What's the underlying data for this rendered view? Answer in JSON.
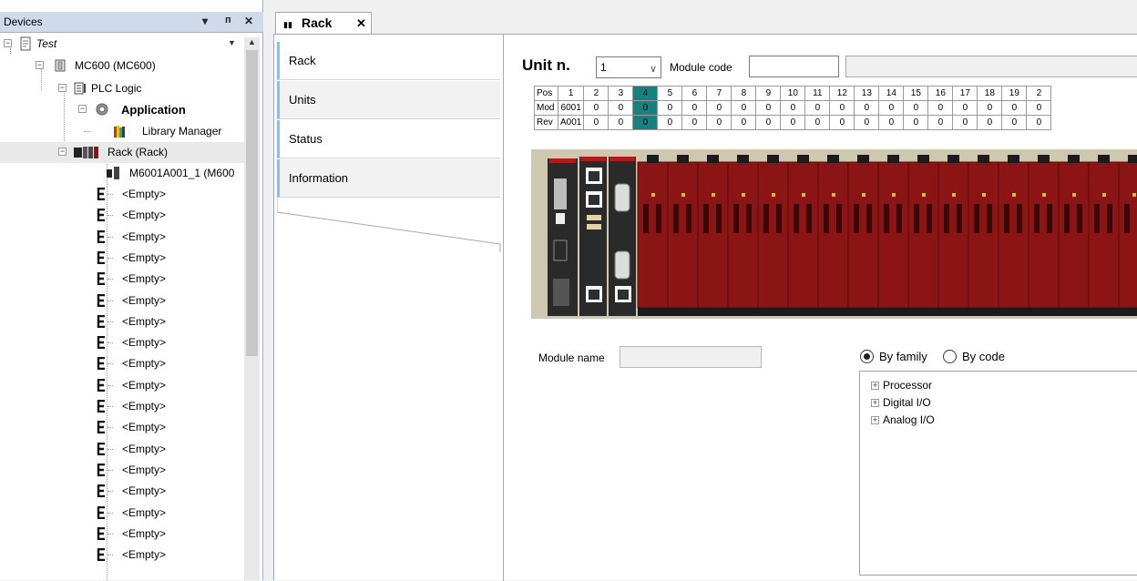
{
  "devices": {
    "title": "Devices",
    "pin_glyph": "▾",
    "pin2_glyph": "ᵖ",
    "close_glyph": "✕",
    "scroll_up_glyph": "▲",
    "root_dd_glyph": "▼",
    "tree": {
      "root": "Test",
      "device": "MC600 (MC600)",
      "plc_logic": "PLC Logic",
      "application": "Application",
      "library_manager": "Library Manager",
      "rack": "Rack (Rack)",
      "module": "M6001A001_1 (M600",
      "empty_slots": [
        "<Empty>",
        "<Empty>",
        "<Empty>",
        "<Empty>",
        "<Empty>",
        "<Empty>",
        "<Empty>",
        "<Empty>",
        "<Empty>",
        "<Empty>",
        "<Empty>",
        "<Empty>",
        "<Empty>",
        "<Empty>",
        "<Empty>",
        "<Empty>",
        "<Empty>",
        "<Empty>"
      ]
    }
  },
  "editor": {
    "tab_label": "Rack",
    "tab_close": "✕",
    "side_tabs": [
      "Rack",
      "Units",
      "Status",
      "Information"
    ],
    "unit_label": "Unit n.",
    "unit_value": "1",
    "unit_arrow": "∨",
    "module_code_label": "Module code",
    "module_code_value": "",
    "grid": {
      "row_headers": [
        "Pos",
        "Mod",
        "Rev"
      ],
      "positions": [
        "1",
        "2",
        "3",
        "4",
        "5",
        "6",
        "7",
        "8",
        "9",
        "10",
        "11",
        "12",
        "13",
        "14",
        "15",
        "16",
        "17",
        "18",
        "19",
        "2"
      ],
      "mod": [
        "6001",
        "0",
        "0",
        "0",
        "0",
        "0",
        "0",
        "0",
        "0",
        "0",
        "0",
        "0",
        "0",
        "0",
        "0",
        "0",
        "0",
        "0",
        "0",
        "0"
      ],
      "rev": [
        "A001",
        "0",
        "0",
        "0",
        "0",
        "0",
        "0",
        "0",
        "0",
        "0",
        "0",
        "0",
        "0",
        "0",
        "0",
        "0",
        "0",
        "0",
        "0",
        "0"
      ],
      "selected_index": 3
    },
    "module_name_label": "Module name",
    "module_name_value": "",
    "radio_family": "By family",
    "radio_code": "By code",
    "module_tree": [
      "Processor",
      "Digital I/O",
      "Analog I/O"
    ]
  },
  "colors": {
    "panel_title_bg": "#cfdbea",
    "selected_cell": "#16827f",
    "rack_red": "#8b1414"
  }
}
